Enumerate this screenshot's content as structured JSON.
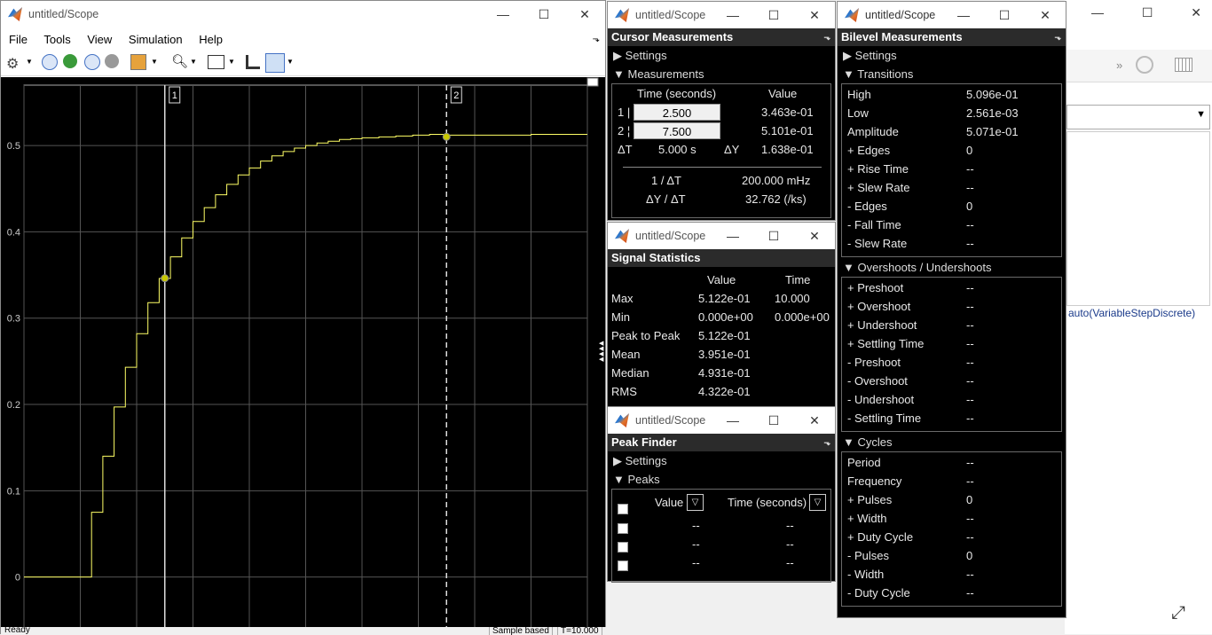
{
  "scope": {
    "title": "untitled/Scope",
    "menu": [
      "File",
      "Tools",
      "View",
      "Simulation",
      "Help"
    ],
    "cursor_labels": [
      "1",
      "2"
    ],
    "status_left": "Ready",
    "status_mid": "Sample based",
    "status_right": "T=10.000"
  },
  "chart_data": {
    "type": "line",
    "x_ticks": [
      "0",
      "1",
      "2",
      "3",
      "4",
      "5",
      "6",
      "7",
      "8",
      "9",
      "10"
    ],
    "y_ticks": [
      "0",
      "0.1",
      "0.2",
      "0.3",
      "0.4",
      "0.5"
    ],
    "xlim": [
      0,
      10
    ],
    "ylim": [
      -0.06,
      0.57
    ],
    "grid": true,
    "series": [
      {
        "color": "#ffff66",
        "x": [
          0,
          1.2,
          1.2,
          1.4,
          1.4,
          1.6,
          1.6,
          1.8,
          1.8,
          2.0,
          2.0,
          2.2,
          2.2,
          2.4,
          2.4,
          2.6,
          2.6,
          2.8,
          2.8,
          3.0,
          3.0,
          3.2,
          3.2,
          3.4,
          3.4,
          3.6,
          3.6,
          3.8,
          3.8,
          4.0,
          4.0,
          4.2,
          4.2,
          4.4,
          4.4,
          4.6,
          4.6,
          4.8,
          4.8,
          5.0,
          5.0,
          5.2,
          5.2,
          5.4,
          5.4,
          5.6,
          5.6,
          5.8,
          5.8,
          6.0,
          6.0,
          6.3,
          6.3,
          6.6,
          6.6,
          6.9,
          6.9,
          7.2,
          7.2,
          7.5,
          7.5,
          8.0,
          8.0,
          9.0,
          9.0,
          10
        ],
        "y": [
          0,
          0,
          0.075,
          0.075,
          0.14,
          0.14,
          0.197,
          0.197,
          0.243,
          0.243,
          0.282,
          0.282,
          0.318,
          0.318,
          0.346,
          0.346,
          0.371,
          0.371,
          0.393,
          0.393,
          0.412,
          0.412,
          0.428,
          0.428,
          0.443,
          0.443,
          0.455,
          0.455,
          0.466,
          0.466,
          0.474,
          0.474,
          0.482,
          0.482,
          0.488,
          0.488,
          0.493,
          0.493,
          0.497,
          0.497,
          0.5,
          0.5,
          0.503,
          0.503,
          0.505,
          0.505,
          0.507,
          0.507,
          0.508,
          0.508,
          0.509,
          0.509,
          0.51,
          0.51,
          0.511,
          0.511,
          0.512,
          0.512,
          0.513,
          0.513,
          0.512,
          0.512,
          0.512,
          0.512,
          0.513,
          0.513
        ]
      }
    ],
    "cursors": [
      {
        "x": 2.5,
        "y": 0.3463
      },
      {
        "x": 7.5,
        "y": 0.5101
      }
    ]
  },
  "cursor": {
    "title": "untitled/Scope",
    "header": "Cursor Measurements",
    "settings": "Settings",
    "measurements": "Measurements",
    "col_time": "Time (seconds)",
    "col_value": "Value",
    "rows": [
      {
        "id": "1",
        "time": "2.500",
        "value": "3.463e-01"
      },
      {
        "id": "2",
        "time": "7.500",
        "value": "5.101e-01"
      }
    ],
    "dt_label": "ΔT",
    "dt": "5.000 s",
    "dy_label": "ΔY",
    "dy": "1.638e-01",
    "inv_label": "1 / ΔT",
    "inv": "200.000 mHz",
    "slope_label": "ΔY / ΔT",
    "slope": "32.762 (/ks)"
  },
  "stats": {
    "title": "untitled/Scope",
    "header": "Signal Statistics",
    "col_value": "Value",
    "col_time": "Time",
    "rows": [
      {
        "label": "Max",
        "value": "5.122e-01",
        "time": "10.000"
      },
      {
        "label": "Min",
        "value": "0.000e+00",
        "time": "0.000e+00"
      },
      {
        "label": "Peak to Peak",
        "value": "5.122e-01",
        "time": ""
      },
      {
        "label": "Mean",
        "value": "3.951e-01",
        "time": ""
      },
      {
        "label": "Median",
        "value": "4.931e-01",
        "time": ""
      },
      {
        "label": "RMS",
        "value": "4.322e-01",
        "time": ""
      }
    ]
  },
  "peak": {
    "title": "untitled/Scope",
    "header": "Peak Finder",
    "settings": "Settings",
    "peaks": "Peaks",
    "col_value": "Value",
    "col_time": "Time (seconds)",
    "rows": [
      {
        "value": "--",
        "time": "--"
      },
      {
        "value": "--",
        "time": "--"
      },
      {
        "value": "--",
        "time": "--"
      }
    ]
  },
  "bilevel": {
    "title": "untitled/Scope",
    "header": "Bilevel Measurements",
    "settings": "Settings",
    "transitions": "Transitions",
    "trans_rows": [
      {
        "label": "High",
        "value": "5.096e-01"
      },
      {
        "label": "Low",
        "value": "2.561e-03"
      },
      {
        "label": "Amplitude",
        "value": "5.071e-01"
      },
      {
        "label": "+ Edges",
        "value": "0"
      },
      {
        "label": "+ Rise Time",
        "value": "--"
      },
      {
        "label": "+ Slew Rate",
        "value": "--"
      },
      {
        "label": "- Edges",
        "value": "0"
      },
      {
        "label": "- Fall Time",
        "value": "--"
      },
      {
        "label": "- Slew Rate",
        "value": "--"
      }
    ],
    "overshoots": "Overshoots / Undershoots",
    "over_rows": [
      {
        "label": "+ Preshoot",
        "value": "--"
      },
      {
        "label": "+ Overshoot",
        "value": "--"
      },
      {
        "label": "+ Undershoot",
        "value": "--"
      },
      {
        "label": "+ Settling Time",
        "value": "--"
      },
      {
        "label": "- Preshoot",
        "value": "--"
      },
      {
        "label": "- Overshoot",
        "value": "--"
      },
      {
        "label": "- Undershoot",
        "value": "--"
      },
      {
        "label": "- Settling Time",
        "value": "--"
      }
    ],
    "cycles": "Cycles",
    "cycle_rows": [
      {
        "label": "Period",
        "value": "--"
      },
      {
        "label": "Frequency",
        "value": "--"
      },
      {
        "label": "+ Pulses",
        "value": "0"
      },
      {
        "label": "+ Width",
        "value": "--"
      },
      {
        "label": "+ Duty Cycle",
        "value": "--"
      },
      {
        "label": "- Pulses",
        "value": "0"
      },
      {
        "label": "- Width",
        "value": "--"
      },
      {
        "label": "- Duty Cycle",
        "value": "--"
      }
    ]
  },
  "background": {
    "solver": "auto(VariableStepDiscrete)"
  }
}
